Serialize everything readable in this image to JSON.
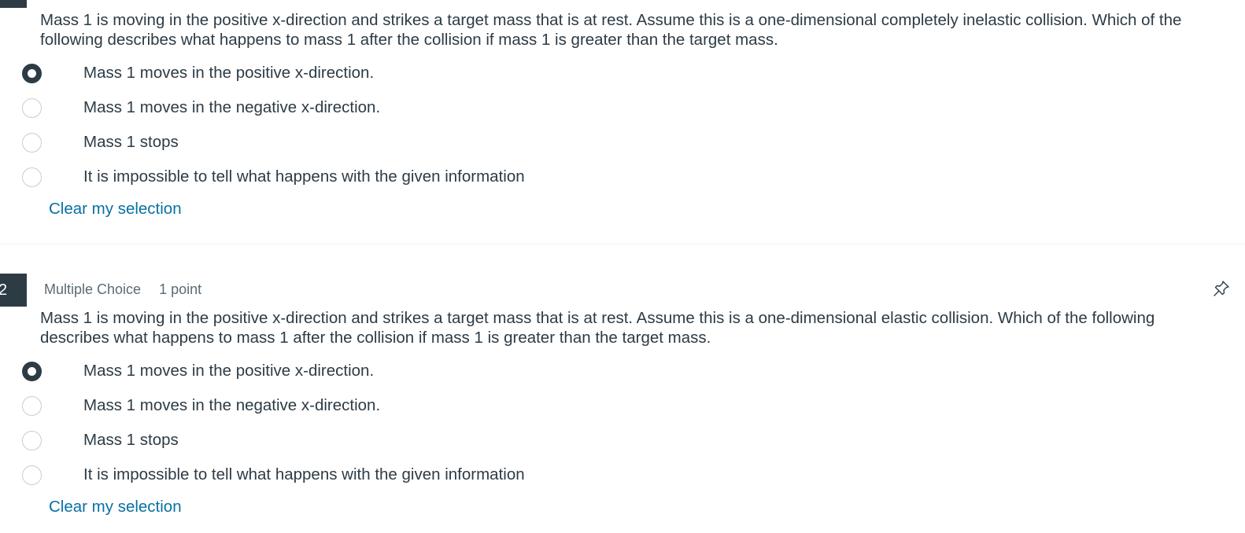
{
  "question1": {
    "text": "Mass 1 is moving in the positive x-direction and strikes a target mass that is at rest. Assume this is a one-dimensional completely inelastic collision. Which of the following describes what happens to mass 1 after the collision if mass 1 is greater than the target mass.",
    "options": [
      {
        "label": "Mass 1 moves in the positive x-direction.",
        "selected": true
      },
      {
        "label": "Mass 1 moves in the negative x-direction.",
        "selected": false
      },
      {
        "label": "Mass 1 stops",
        "selected": false
      },
      {
        "label": "It is impossible to tell what happens with the given information",
        "selected": false
      }
    ],
    "clear_label": "Clear my selection"
  },
  "question2": {
    "number": "2",
    "type": "Multiple Choice",
    "points": "1 point",
    "pin_icon": "pin-icon",
    "text": "Mass 1 is moving in the positive x-direction and strikes a target mass that is at rest. Assume this is a one-dimensional elastic collision. Which of the following describes what happens to mass 1 after the collision if mass 1 is greater than the target mass.",
    "options": [
      {
        "label": "Mass 1 moves in the positive x-direction.",
        "selected": true
      },
      {
        "label": "Mass 1 moves in the negative x-direction.",
        "selected": false
      },
      {
        "label": "Mass 1 stops",
        "selected": false
      },
      {
        "label": "It is impossible to tell what happens with the given information",
        "selected": false
      }
    ],
    "clear_label": "Clear my selection"
  },
  "colors": {
    "text": "#2d3b45",
    "link": "#0770a3",
    "question_number_bg": "#2d3b45",
    "meta_text": "#5b6b75"
  }
}
